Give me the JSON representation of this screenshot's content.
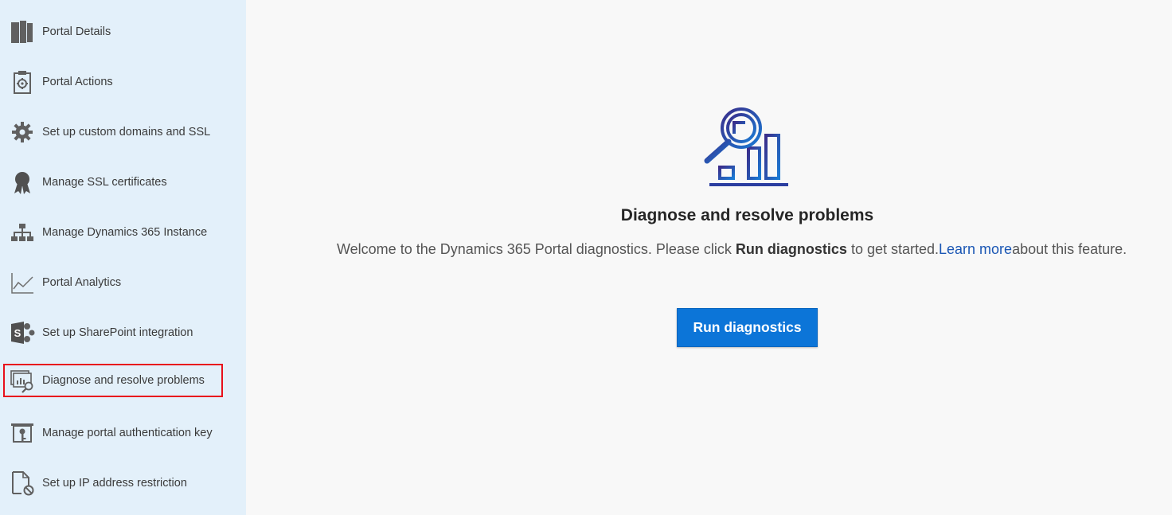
{
  "sidebar": {
    "items": [
      {
        "label": "Portal Details",
        "icon": "portal-details-icon"
      },
      {
        "label": "Portal Actions",
        "icon": "portal-actions-icon"
      },
      {
        "label": "Set up custom domains and SSL",
        "icon": "gear-icon"
      },
      {
        "label": "Manage SSL certificates",
        "icon": "certificate-ribbon-icon"
      },
      {
        "label": "Manage Dynamics 365 Instance",
        "icon": "hierarchy-icon"
      },
      {
        "label": "Portal Analytics",
        "icon": "line-chart-icon"
      },
      {
        "label": "Set up SharePoint integration",
        "icon": "sharepoint-icon"
      },
      {
        "label": "Diagnose and resolve problems",
        "icon": "diagnose-icon",
        "selected": true
      },
      {
        "label": "Manage portal authentication key",
        "icon": "key-icon"
      },
      {
        "label": "Set up IP address restriction",
        "icon": "ip-restriction-icon"
      }
    ]
  },
  "main": {
    "icon": "diagnostics-chart-magnifier-icon",
    "title": "Diagnose and resolve problems",
    "welcome_prefix": "Welcome to the Dynamics 365 Portal diagnostics. Please click",
    "welcome_bold": "Run diagnostics",
    "welcome_middle": "to get started.",
    "learn_more": "Learn more",
    "welcome_suffix": "about this feature.",
    "run_button": "Run diagnostics"
  },
  "colors": {
    "sidebar_bg": "#e3f0fa",
    "main_bg": "#f8f8f8",
    "accent_button": "#0c75d8",
    "selection_border": "#e8101c",
    "link": "#1a56b4"
  }
}
